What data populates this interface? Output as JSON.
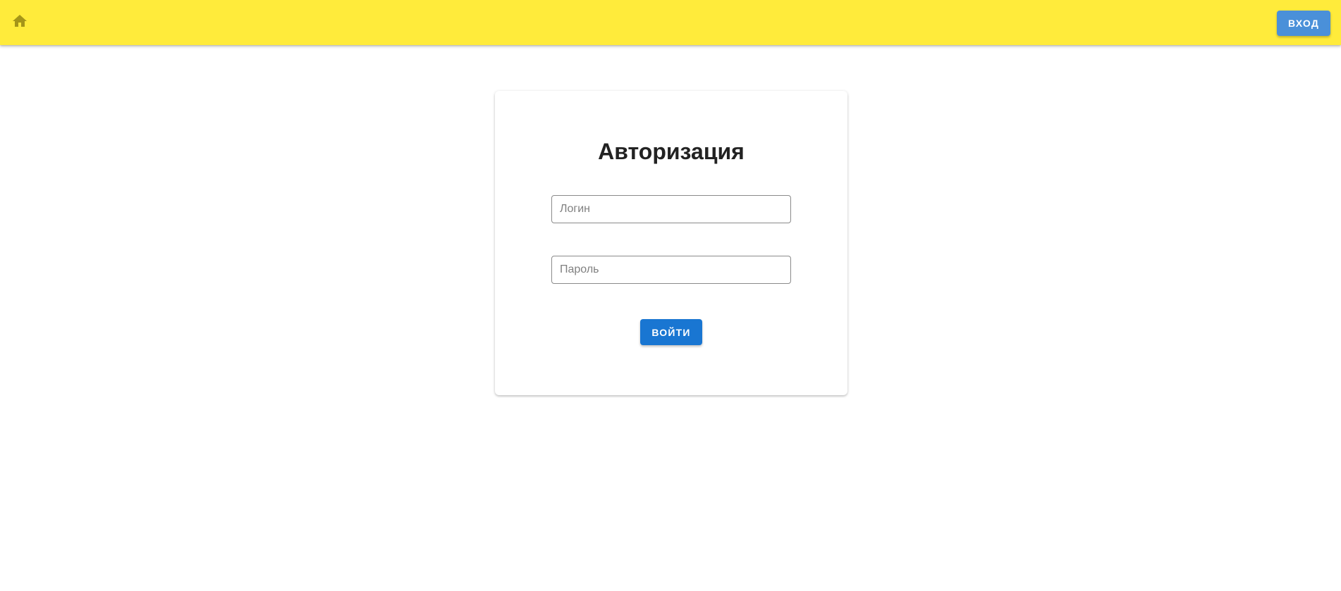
{
  "header": {
    "home_icon": "home-icon",
    "login_button_label": "ВХОД",
    "bar_color": "#ffeb3b",
    "icon_color": "#a59518",
    "button_color": "#4a90d9"
  },
  "auth_form": {
    "title": "Авторизация",
    "login_placeholder": "Логин",
    "login_value": "",
    "password_placeholder": "Пароль",
    "password_value": "",
    "submit_label": "ВОЙТИ",
    "submit_color": "#1976d2"
  }
}
